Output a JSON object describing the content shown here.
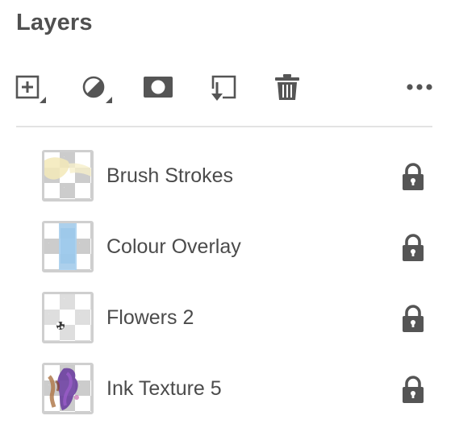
{
  "panel": {
    "title": "Layers"
  },
  "toolbar": {
    "tools": [
      {
        "name": "add-layer",
        "icon": "plus-square-icon"
      },
      {
        "name": "adjustment-layer",
        "icon": "half-circle-icon"
      },
      {
        "name": "add-mask",
        "icon": "mask-icon"
      },
      {
        "name": "clip-to-layer-below",
        "icon": "clip-arrow-icon"
      },
      {
        "name": "delete-layer",
        "icon": "trash-icon"
      },
      {
        "name": "more-options",
        "icon": "ellipsis-icon"
      }
    ]
  },
  "layers": [
    {
      "name": "Brush Strokes",
      "locked": true,
      "thumbnail": "yellow-brush-strokes"
    },
    {
      "name": "Colour Overlay",
      "locked": true,
      "thumbnail": "blue-overlay"
    },
    {
      "name": "Flowers 2",
      "locked": true,
      "thumbnail": "small-flowers"
    },
    {
      "name": "Ink Texture 5",
      "locked": true,
      "thumbnail": "purple-ink"
    }
  ],
  "colors": {
    "icon": "#555555",
    "text": "#4b4b4b",
    "divider": "#e3e3e3",
    "thumb_border": "#cfcfcf"
  }
}
